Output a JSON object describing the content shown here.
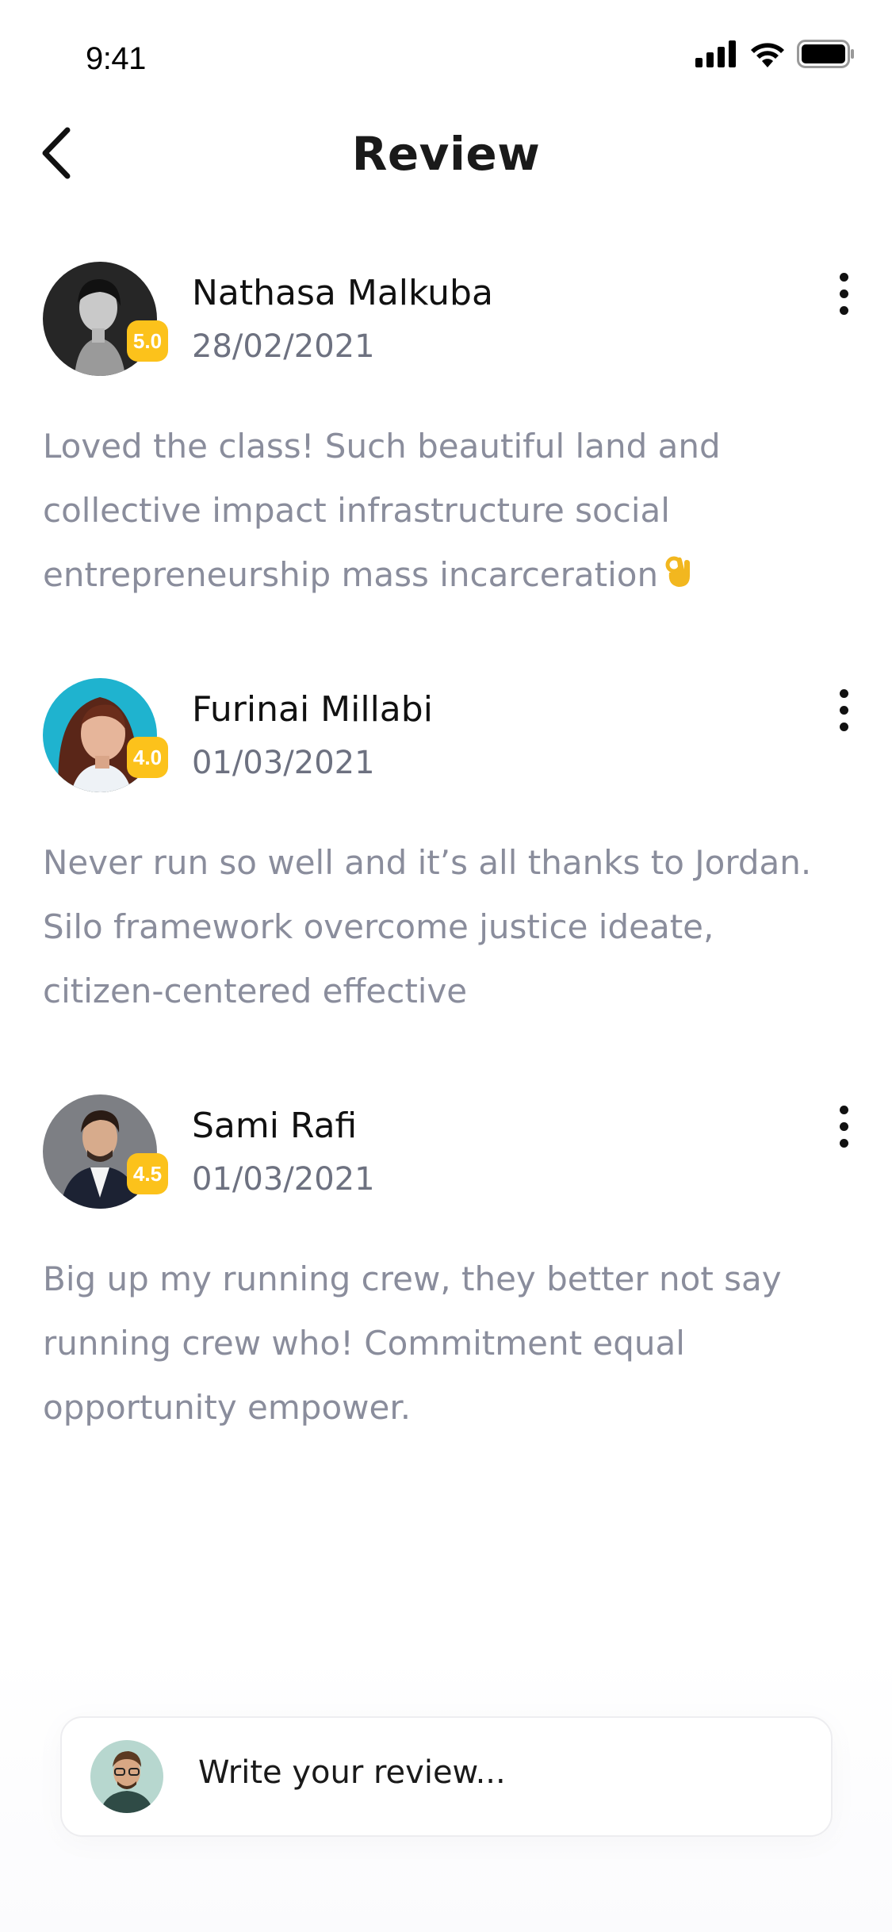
{
  "status_bar": {
    "time": "9:41",
    "icons": [
      "cellular-signal-icon",
      "wifi-icon",
      "battery-icon"
    ]
  },
  "header": {
    "title": "Review",
    "back_icon": "chevron-left-icon"
  },
  "reviews": [
    {
      "name": "Nathasa Malkuba",
      "date": "28/02/2021",
      "rating": "5.0",
      "text": "Loved the class! Such beautiful land and collective impact infrastructure social entrepreneurship mass incarceration",
      "emoji": "ok-hand-emoji"
    },
    {
      "name": "Furinai Millabi",
      "date": "01/03/2021",
      "rating": "4.0",
      "text": "Never run so well and it’s all thanks to Jordan. Silo framework overcome justice ideate, citizen-centered effective"
    },
    {
      "name": "Sami Rafi",
      "date": "01/03/2021",
      "rating": "4.5",
      "text": "Big up my running crew, they better not say running crew who! Commitment equal opportunity empower."
    }
  ],
  "write_review": {
    "placeholder": "Write your review..."
  },
  "colors": {
    "badge": "#fcc21b",
    "body_text": "#8a8d9c",
    "date_text": "#6d7180",
    "title_text": "#1a1a1a"
  }
}
